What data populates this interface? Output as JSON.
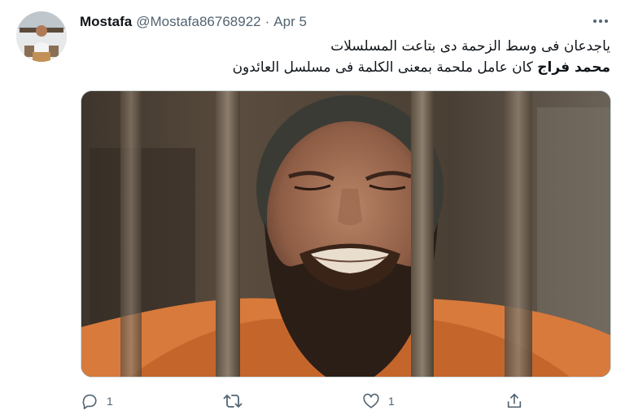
{
  "tweet": {
    "author_name": "Mostafa",
    "author_handle": "@Mostafa86768922",
    "separator": "·",
    "date": "Apr 5",
    "text_line1": "ياجدعان فى وسط الزحمة دى بتاعت المسلسلات",
    "text_line2_bold": "محمد فراج",
    "text_line2_rest": "كان عامل ملحمة بمعنى الكلمة فى مسلسل العائدون"
  },
  "actions": {
    "reply_count": "1",
    "retweet_count": "",
    "like_count": "1"
  },
  "icons": {
    "more": "more-horizontal-icon",
    "reply": "reply-icon",
    "retweet": "retweet-icon",
    "like": "heart-icon",
    "share": "share-icon"
  },
  "colors": {
    "text_primary": "#0f1419",
    "text_secondary": "#536471",
    "border": "#cfd9de"
  }
}
